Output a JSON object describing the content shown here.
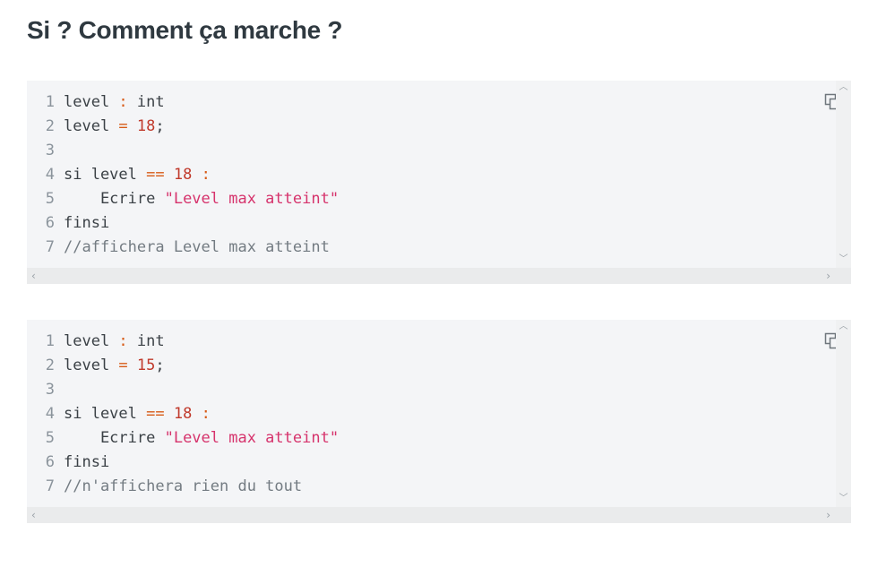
{
  "heading": "Si ? Comment ça marche ?",
  "blocks": [
    {
      "copy_icon": "copy-icon",
      "lines": [
        {
          "n": "1",
          "parts": [
            [
              "txt",
              "level "
            ],
            [
              "op",
              ":"
            ],
            [
              "txt",
              " int"
            ]
          ]
        },
        {
          "n": "2",
          "parts": [
            [
              "txt",
              "level "
            ],
            [
              "op",
              "="
            ],
            [
              "txt",
              " "
            ],
            [
              "num",
              "18"
            ],
            [
              "txt",
              ";"
            ]
          ]
        },
        {
          "n": "3",
          "parts": []
        },
        {
          "n": "4",
          "parts": [
            [
              "txt",
              "si level "
            ],
            [
              "op",
              "=="
            ],
            [
              "txt",
              " "
            ],
            [
              "num",
              "18"
            ],
            [
              "txt",
              " "
            ],
            [
              "op",
              ":"
            ]
          ]
        },
        {
          "n": "5",
          "parts": [
            [
              "txt",
              "    Ecrire "
            ],
            [
              "str",
              "\"Level max atteint\""
            ]
          ]
        },
        {
          "n": "6",
          "parts": [
            [
              "txt",
              "finsi"
            ]
          ]
        },
        {
          "n": "7",
          "parts": [
            [
              "cmt",
              "//affichera Level max atteint"
            ]
          ]
        }
      ]
    },
    {
      "copy_icon": "copy-icon",
      "lines": [
        {
          "n": "1",
          "parts": [
            [
              "txt",
              "level "
            ],
            [
              "op",
              ":"
            ],
            [
              "txt",
              " int"
            ]
          ]
        },
        {
          "n": "2",
          "parts": [
            [
              "txt",
              "level "
            ],
            [
              "op",
              "="
            ],
            [
              "txt",
              " "
            ],
            [
              "num",
              "15"
            ],
            [
              "txt",
              ";"
            ]
          ]
        },
        {
          "n": "3",
          "parts": []
        },
        {
          "n": "4",
          "parts": [
            [
              "txt",
              "si level "
            ],
            [
              "op",
              "=="
            ],
            [
              "txt",
              " "
            ],
            [
              "num",
              "18"
            ],
            [
              "txt",
              " "
            ],
            [
              "op",
              ":"
            ]
          ]
        },
        {
          "n": "5",
          "parts": [
            [
              "txt",
              "    Ecrire "
            ],
            [
              "str",
              "\"Level max atteint\""
            ]
          ]
        },
        {
          "n": "6",
          "parts": [
            [
              "txt",
              "finsi"
            ]
          ]
        },
        {
          "n": "7",
          "parts": [
            [
              "cmt",
              "//n'affichera rien du tout"
            ]
          ]
        }
      ]
    }
  ]
}
